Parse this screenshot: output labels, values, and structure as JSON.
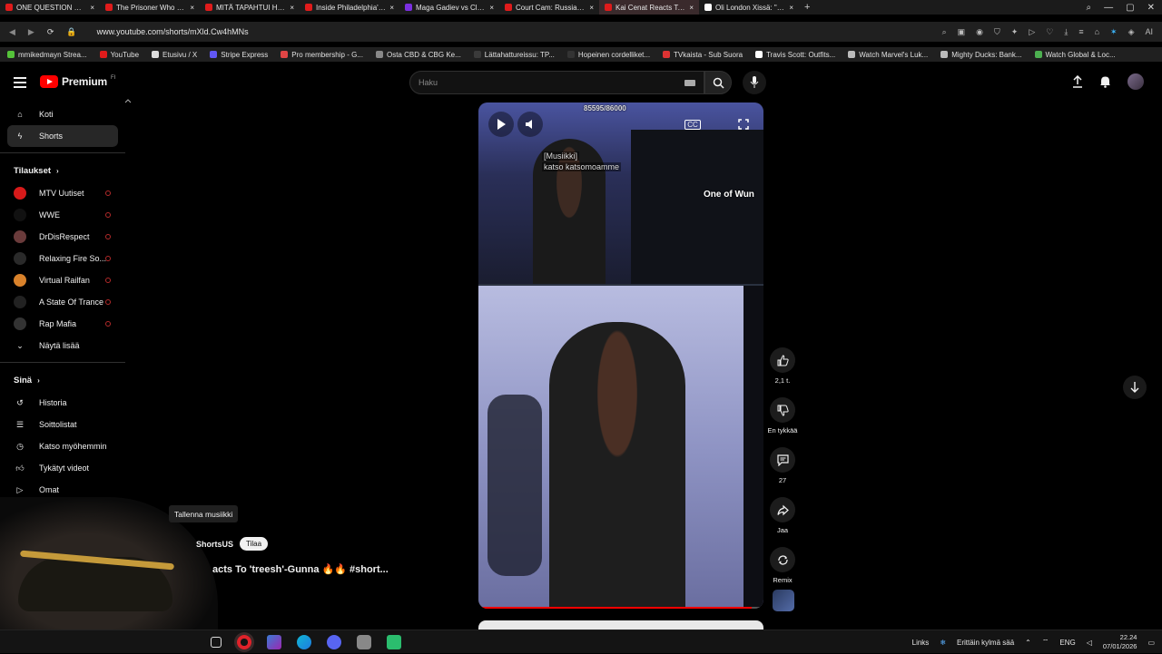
{
  "browser": {
    "tabs": [
      {
        "title": "ONE QUESTION GO IS BA",
        "color": "#e01b1b"
      },
      {
        "title": "The Prisoner Who Made t",
        "color": "#e01b1b"
      },
      {
        "title": "MITÄ TAPAHTUI HOTELLI",
        "color": "#e01b1b"
      },
      {
        "title": "Inside Philadelphia's Real",
        "color": "#e01b1b"
      },
      {
        "title": "Maga Gadiev vs Claudia",
        "color": "#7b2fe0"
      },
      {
        "title": "Court Cam: Russian Man",
        "color": "#e01b1b"
      },
      {
        "title": "Kai Cenat Reacts To 'trees",
        "color": "#e01b1b",
        "active": true
      },
      {
        "title": "Oli London Xissä: \"Transg",
        "color": "#ffffff"
      }
    ],
    "url": "www.youtube.com/shorts/mXld.Cw4hMNs",
    "bookmarks": [
      {
        "label": "mmikedmayn Strea...",
        "color": "#55c33a"
      },
      {
        "label": "YouTube",
        "color": "#e01b1b"
      },
      {
        "label": "Etusivu / X",
        "color": "#dddddd"
      },
      {
        "label": "Stripe Express",
        "color": "#6157f5"
      },
      {
        "label": "Pro membership - G...",
        "color": "#e04545"
      },
      {
        "label": "Osta CBD & CBG Ke...",
        "color": "#888888"
      },
      {
        "label": "Lättahattureissu: TP...",
        "color": "#3a3a3a"
      },
      {
        "label": "Hopeinen cordelliket...",
        "color": "#333333"
      },
      {
        "label": "TVkaista - Sub Suora",
        "color": "#d33"
      },
      {
        "label": "Travis Scott: Outfits...",
        "color": "#ffffff"
      },
      {
        "label": "Watch Marvel's Luk...",
        "color": "#bbbbbb"
      },
      {
        "label": "Mighty Ducks: Bank...",
        "color": "#bbbbbb"
      },
      {
        "label": "Watch Global & Loc...",
        "color": "#4caf50"
      }
    ]
  },
  "header": {
    "logo_text": "Premium",
    "logo_sup": "FI",
    "search_placeholder": "Haku"
  },
  "sidebar": {
    "main": [
      {
        "label": "Koti",
        "icon": "home-icon"
      },
      {
        "label": "Shorts",
        "icon": "shorts-icon",
        "active": true
      }
    ],
    "subs_title": "Tilaukset",
    "subs": [
      {
        "label": "MTV Uutiset",
        "color": "#d71a1a"
      },
      {
        "label": "WWE",
        "color": "#111111"
      },
      {
        "label": "DrDisRespect",
        "color": "#6a3b3b"
      },
      {
        "label": "Relaxing Fire So...",
        "color": "#2a2a2a"
      },
      {
        "label": "Virtual Railfan",
        "color": "#d9822b"
      },
      {
        "label": "A State Of Trance",
        "color": "#222222"
      },
      {
        "label": "Rap Mafia",
        "color": "#333333"
      }
    ],
    "show_more": "Näytä lisää",
    "you_title": "Sinä",
    "you": [
      {
        "label": "Historia",
        "icon": "history-icon"
      },
      {
        "label": "Soittolistat",
        "icon": "playlist-icon"
      },
      {
        "label": "Katso myöhemmin",
        "icon": "clock-icon"
      },
      {
        "label": "Tykätyt videot",
        "icon": "like-icon"
      },
      {
        "label": "Omat",
        "icon": "video-icon"
      }
    ]
  },
  "player": {
    "overlay_counter": "85595/86000",
    "caption_line1": "[Musiikki]",
    "caption_line2": "katso katsomoamme",
    "badge": "One of Wun",
    "progress": 0.96
  },
  "actions": {
    "like_count": "2,1 t.",
    "dislike_label": "En tykkää",
    "comment_count": "27",
    "share_label": "Jaa",
    "remix_label": "Remix"
  },
  "overlay": {
    "save_tooltip": "Tallenna musiikki",
    "channel": "ShortsUS",
    "subscribe": "Tilaa",
    "title": "acts To 'treesh'-Gunna 🔥🔥 #short..."
  },
  "taskbar": {
    "links": "Links",
    "weather": "Erittäin kylmä sää",
    "lang": "ENG",
    "time": "22.24",
    "date": "07/01/2026"
  }
}
